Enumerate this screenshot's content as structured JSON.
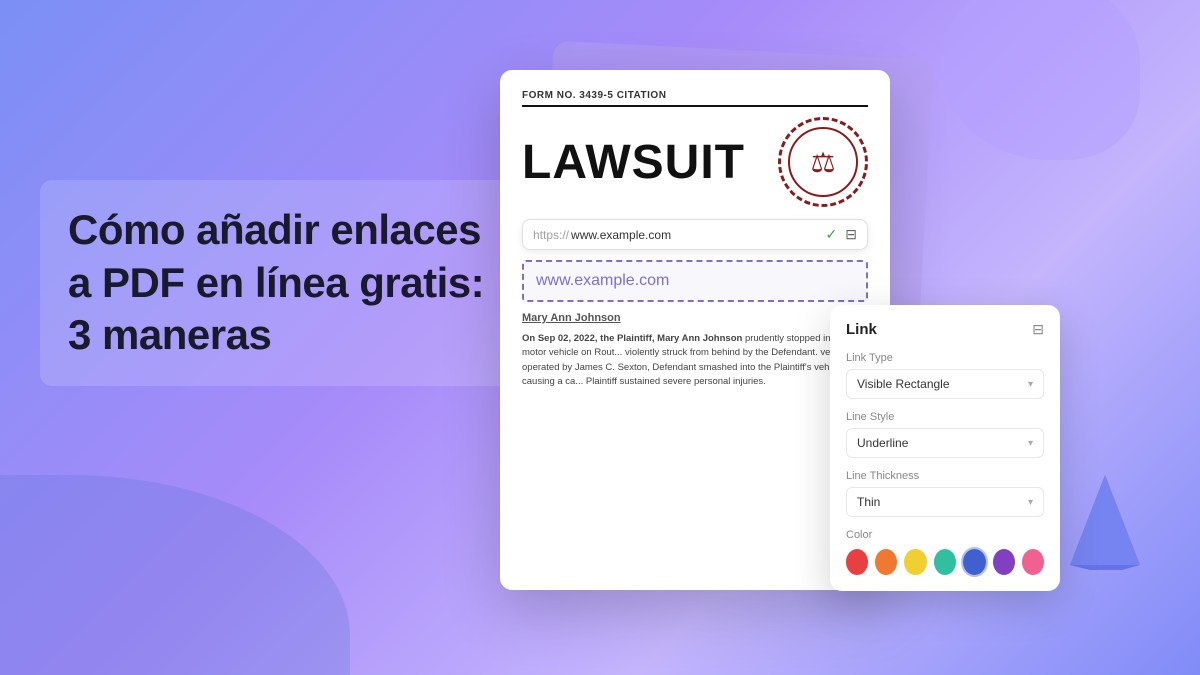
{
  "background": {
    "gradient_start": "#7b8ff5",
    "gradient_end": "#c4b5fd"
  },
  "title": {
    "text": "Cómo añadir enlaces a PDF en línea gratis: 3 maneras"
  },
  "pdf_card": {
    "form_number": "FORM NO. 3439-5 CITATION",
    "lawsuit_title": "LAWSUIT",
    "url_bar": {
      "prefix": "https://",
      "url": "www.example.com"
    },
    "link_example": "www.example.com",
    "author_name": "Mary Ann Johnson",
    "body_text": "On Sep 02, 2022, the Plaintiff, Mary Ann Johnson prudently stopped in her motor vehicle on Route... violently struck from behind by the Defendant. vehicle operated by James C. Sexton, Defendant smashed into the Plaintiff's vehicle, causing a ca... Plaintiff sustained severe personal injuries."
  },
  "link_panel": {
    "title": "Link",
    "link_type_label": "Link Type",
    "link_type_value": "Visible Rectangle",
    "line_style_label": "Line Style",
    "line_style_value": "Underline",
    "line_thickness_label": "Line Thickness",
    "line_thickness_value": "Thin",
    "color_label": "Color",
    "colors": [
      "#e84040",
      "#f07830",
      "#f0d030",
      "#30c0a0",
      "#4060d0",
      "#8040c0",
      "#f06090"
    ]
  },
  "icons": {
    "settings": "⚙",
    "check": "✓",
    "filter": "≡",
    "arrow_down": "▾",
    "scales": "⚖"
  }
}
